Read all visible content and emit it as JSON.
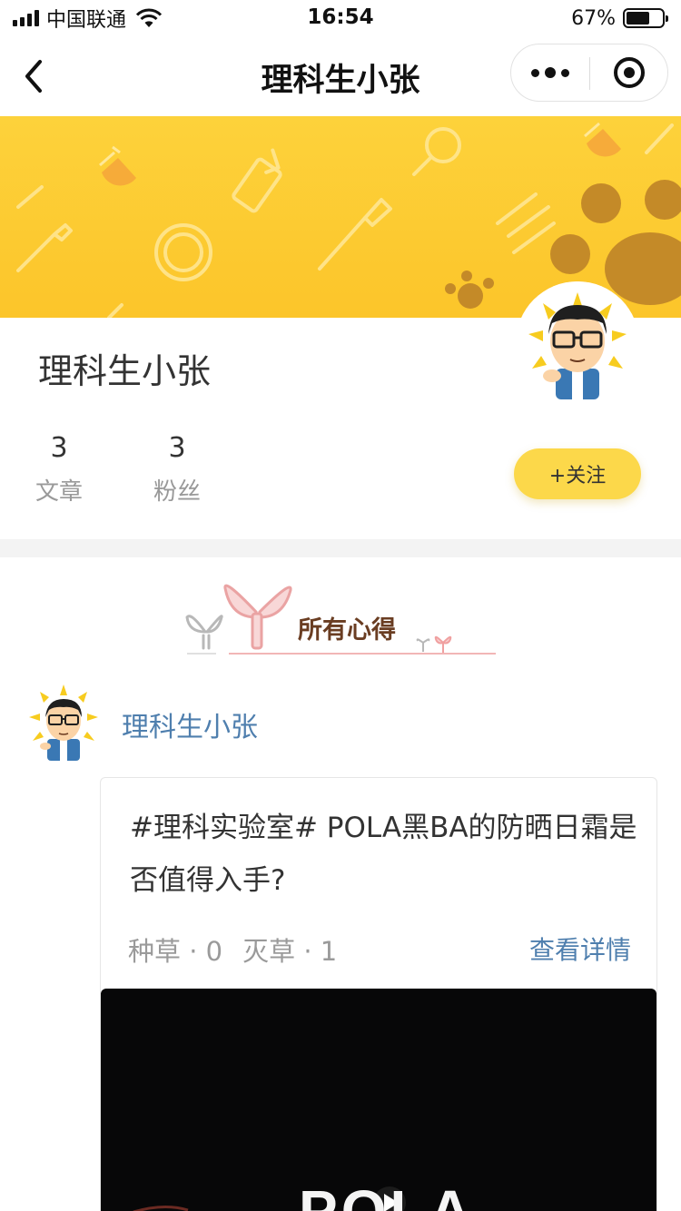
{
  "status_bar": {
    "carrier": "中国联通",
    "time": "16:54",
    "battery_pct": "67%",
    "battery_level": 0.67
  },
  "nav": {
    "title": "理科生小张",
    "back_icon": "chevron-left-icon",
    "more_icon": "more-dots-icon",
    "close_icon": "target-circle-icon"
  },
  "profile": {
    "name": "理科生小张",
    "stats": [
      {
        "value": "3",
        "label": "文章"
      },
      {
        "value": "3",
        "label": "粉丝"
      }
    ],
    "follow_label": "+关注"
  },
  "section": {
    "title": "所有心得"
  },
  "post": {
    "author": "理科生小张",
    "title": "#理科实验室# POLA黑BA的防晒日霜是否值得入手?",
    "meta_like": "种草 · 0",
    "meta_dislike": "灭草 · 1",
    "detail_label": "查看详情",
    "video_brand": "POLA"
  },
  "colors": {
    "banner": "#fdd23b",
    "follow_button": "#fcd84a",
    "link": "#4f7fae",
    "section_title": "#6a3d22"
  }
}
